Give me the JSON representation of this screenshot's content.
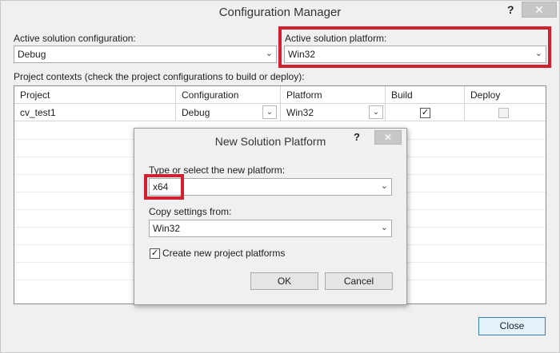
{
  "window": {
    "title": "Configuration Manager",
    "help": "?",
    "close": "✕",
    "active_config_label": "Active solution configuration:",
    "active_config_value": "Debug",
    "active_platform_label": "Active solution platform:",
    "active_platform_value": "Win32",
    "contexts_label": "Project contexts (check the project configurations to build or deploy):",
    "close_button": "Close",
    "highlight_color": "#d1202f"
  },
  "grid": {
    "columns": [
      "Project",
      "Configuration",
      "Platform",
      "Build",
      "Deploy"
    ],
    "rows": [
      {
        "project": "cv_test1",
        "configuration": "Debug",
        "platform": "Win32",
        "build": true,
        "deploy": false
      }
    ]
  },
  "dialog": {
    "title": "New Solution Platform",
    "help": "?",
    "close": "✕",
    "platform_label": "Type or select the new platform:",
    "platform_value": "x64",
    "copy_label": "Copy settings from:",
    "copy_value": "Win32",
    "create_label": "Create new project platforms",
    "create_checked": true,
    "ok": "OK",
    "cancel": "Cancel"
  }
}
